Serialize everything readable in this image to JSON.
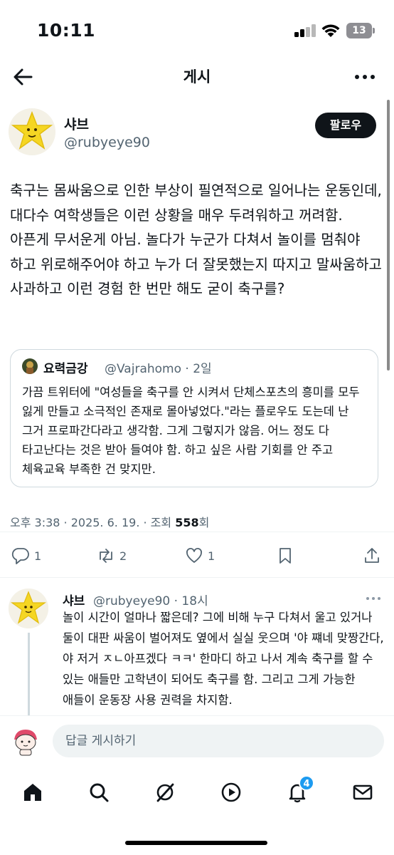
{
  "status_bar": {
    "time": "10:11",
    "battery": "13"
  },
  "header": {
    "title": "게시"
  },
  "post": {
    "author_name": "샤브",
    "author_handle": "@rubyeye90",
    "follow_label": "팔로우",
    "body": "축구는 몸싸움으로 인한 부상이 필연적으로 일어나는 운동인데, 대다수 여학생들은 이런 상황을 매우 두려워하고 꺼려함. 아픈게 무서운게 아님. 놀다가 누군가 다쳐서 놀이를 멈춰야 하고 위로해주어야 하고 누가 더 잘못했는지 따지고 말싸움하고 사과하고 이런 경험 한 번만 해도 굳이 축구를?",
    "quote": {
      "name": "요력금강",
      "handle": "@Vajrahomo · 2일",
      "body": "가끔 트위터에 \"여성들을 축구를 안 시켜서 단체스포츠의 흥미를 모두 잃게 만들고 소극적인 존재로 몰아넣었다.\"라는 플로우도 도는데 난 그거 프로파간다라고 생각함. 그게 그렇지가 않음. 어느 정도 다 타고난다는 것은 받아 들여야 함. 하고 싶은 사람 기회를 안 주고 체육교육 부족한 건 맞지만."
    },
    "meta": {
      "time": "오후 3:38 · 2025. 6. 19. · 조회 ",
      "views": "558",
      "views_suffix": "회"
    },
    "actions": {
      "replies": "1",
      "reposts": "2",
      "likes": "1"
    }
  },
  "reply": {
    "name": "샤브",
    "handle": "@rubyeye90 · 18시",
    "body": "놀이 시간이 얼마나 짧은데? 그에 비해 누구 다쳐서 울고 있거나 둘이 대판 싸움이 벌어져도 옆에서 실실 웃으며 '야 쨰네 맞짱간다, 야 저거 ㅈㄴ아프겠다 ㅋㅋ' 한마디 하고 나서 계속 축구를 할 수 있는 애들만 고학년이 되어도 축구를 함. 그리고 그게 가능한 애들이 운동장 사용 권력을 차지함."
  },
  "compose": {
    "placeholder": "답글 게시하기"
  },
  "tab_bar": {
    "notification_count": "4"
  },
  "icons": {
    "back": "arrow-left-icon",
    "more": "more-horizontal-icon",
    "reply": "reply-icon",
    "repost": "repost-icon",
    "like": "heart-icon",
    "bookmark": "bookmark-icon",
    "share": "share-icon",
    "home": "home-icon",
    "search": "search-icon",
    "grok": "grok-icon",
    "video": "play-icon",
    "notifications": "bell-icon",
    "messages": "mail-icon"
  },
  "colors": {
    "accent": "#1d9bf0",
    "text": "#0f1419",
    "secondary": "#536471",
    "border": "#cfd9de"
  }
}
